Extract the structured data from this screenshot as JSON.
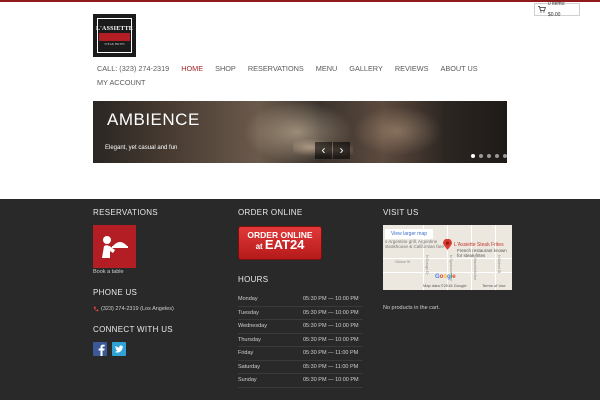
{
  "cart": {
    "label": "0 items: $0.00"
  },
  "logo": {
    "line1": "L'ASSIETTE",
    "line2": "STEAK FRITES"
  },
  "nav": {
    "phone": "CALL: (323) 274-2319",
    "items": [
      "HOME",
      "SHOP",
      "RESERVATIONS",
      "MENU",
      "GALLERY",
      "REVIEWS",
      "ABOUT US"
    ],
    "active": "HOME",
    "account": "MY ACCOUNT"
  },
  "slider": {
    "title": "AMBIENCE",
    "caption": "Elegant, yet casual and fun",
    "prev_glyph": "‹",
    "next_glyph": "›",
    "dot_count": 5,
    "active_dot": 0
  },
  "footer": {
    "reservations": {
      "title": "RESERVATIONS",
      "link": "Book a table"
    },
    "phone": {
      "title": "PHONE US",
      "value": "(323) 274-2319 (Los Angeles)"
    },
    "connect": {
      "title": "CONNECT WITH US",
      "icons": [
        "facebook-icon",
        "twitter-icon"
      ]
    },
    "order": {
      "title": "ORDER ONLINE",
      "button_line1": "ORDER ONLINE",
      "button_at": "at",
      "button_brand": "EAT24"
    },
    "hours": {
      "title": "HOURS",
      "rows": [
        {
          "day": "Monday",
          "time": "05:30 PM — 10:00 PM"
        },
        {
          "day": "Tuesday",
          "time": "05:30 PM — 10:00 PM"
        },
        {
          "day": "Wednesday",
          "time": "05:30 PM — 10:00 PM"
        },
        {
          "day": "Thursday",
          "time": "05:30 PM — 10:00 PM"
        },
        {
          "day": "Friday",
          "time": "05:30 PM — 11:00 PM"
        },
        {
          "day": "Saturday",
          "time": "05:30 PM — 11:00 PM"
        },
        {
          "day": "Sunday",
          "time": "05:30 PM — 10:00 PM"
        }
      ]
    },
    "visit": {
      "title": "VISIT US",
      "map": {
        "larger_link": "View larger map",
        "place": "L'Assiette Steak Frites",
        "desc": "French restaurant known for steak frites",
        "partial_left": "s Argentine grill, Argentine steakhouse & Californian fare",
        "streets": [
          "Clinton St",
          "N Orange Dr",
          "N Sycamore Ave",
          "N Mansfield Ave",
          "N Detroit St"
        ],
        "google": "Google",
        "attribution": "Map data ©2018 Google",
        "terms": "Terms of Use"
      },
      "cart_note": "No products in the cart."
    }
  },
  "colors": {
    "accent": "#8e1a1a",
    "brand_red": "#b31d24",
    "footer_bg": "#292929",
    "facebook": "#3b5998",
    "twitter": "#2fa3d6"
  }
}
